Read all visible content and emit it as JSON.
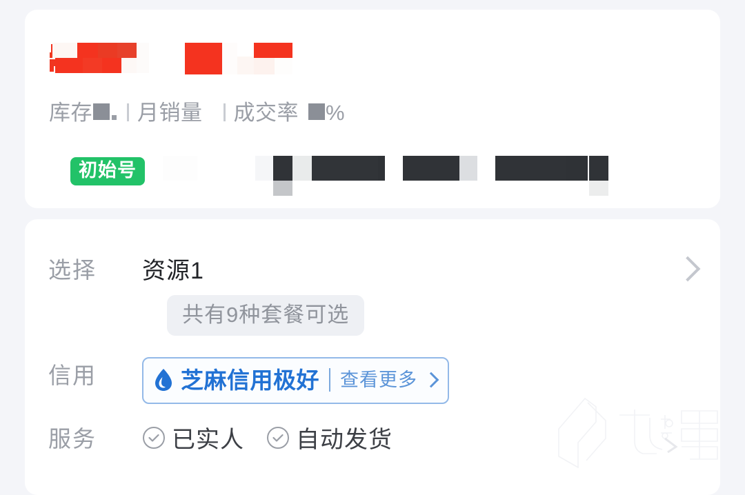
{
  "page": {
    "background_color": "#f4f5f9",
    "card_color": "#ffffff",
    "watermark_text": "九游"
  },
  "product": {
    "price_redacted": true,
    "redaction_color_price": "#f4331f",
    "redaction_color_stat": "#8b8f97",
    "stats": {
      "stock_label": "库存",
      "stock_value": "",
      "sales_label": "月销量",
      "sales_value": "",
      "rate_label": "成交率",
      "rate_value": "",
      "percent_symbol": "%"
    },
    "tags": [
      {
        "label": "初始号",
        "color": "#22c268",
        "text_color": "#ffffff"
      }
    ],
    "redacted_tags_color": "#303337"
  },
  "options": {
    "select": {
      "label": "选择",
      "value": "资源1",
      "chevron": "chevron-right-icon",
      "package_pill": "共有9种套餐可选"
    },
    "credit": {
      "label": "信用",
      "icon": "sesame-droplet-icon",
      "badge_text": "芝麻信用极好",
      "more_text": "查看更多",
      "more_chevron": "chevron-right-icon",
      "accent_color": "#2272d4",
      "border_color": "#93b9e8"
    },
    "service": {
      "label": "服务",
      "items": [
        {
          "icon": "check-circle-icon",
          "label": "已实人"
        },
        {
          "icon": "check-circle-icon",
          "label": "自动发货"
        }
      ]
    }
  }
}
